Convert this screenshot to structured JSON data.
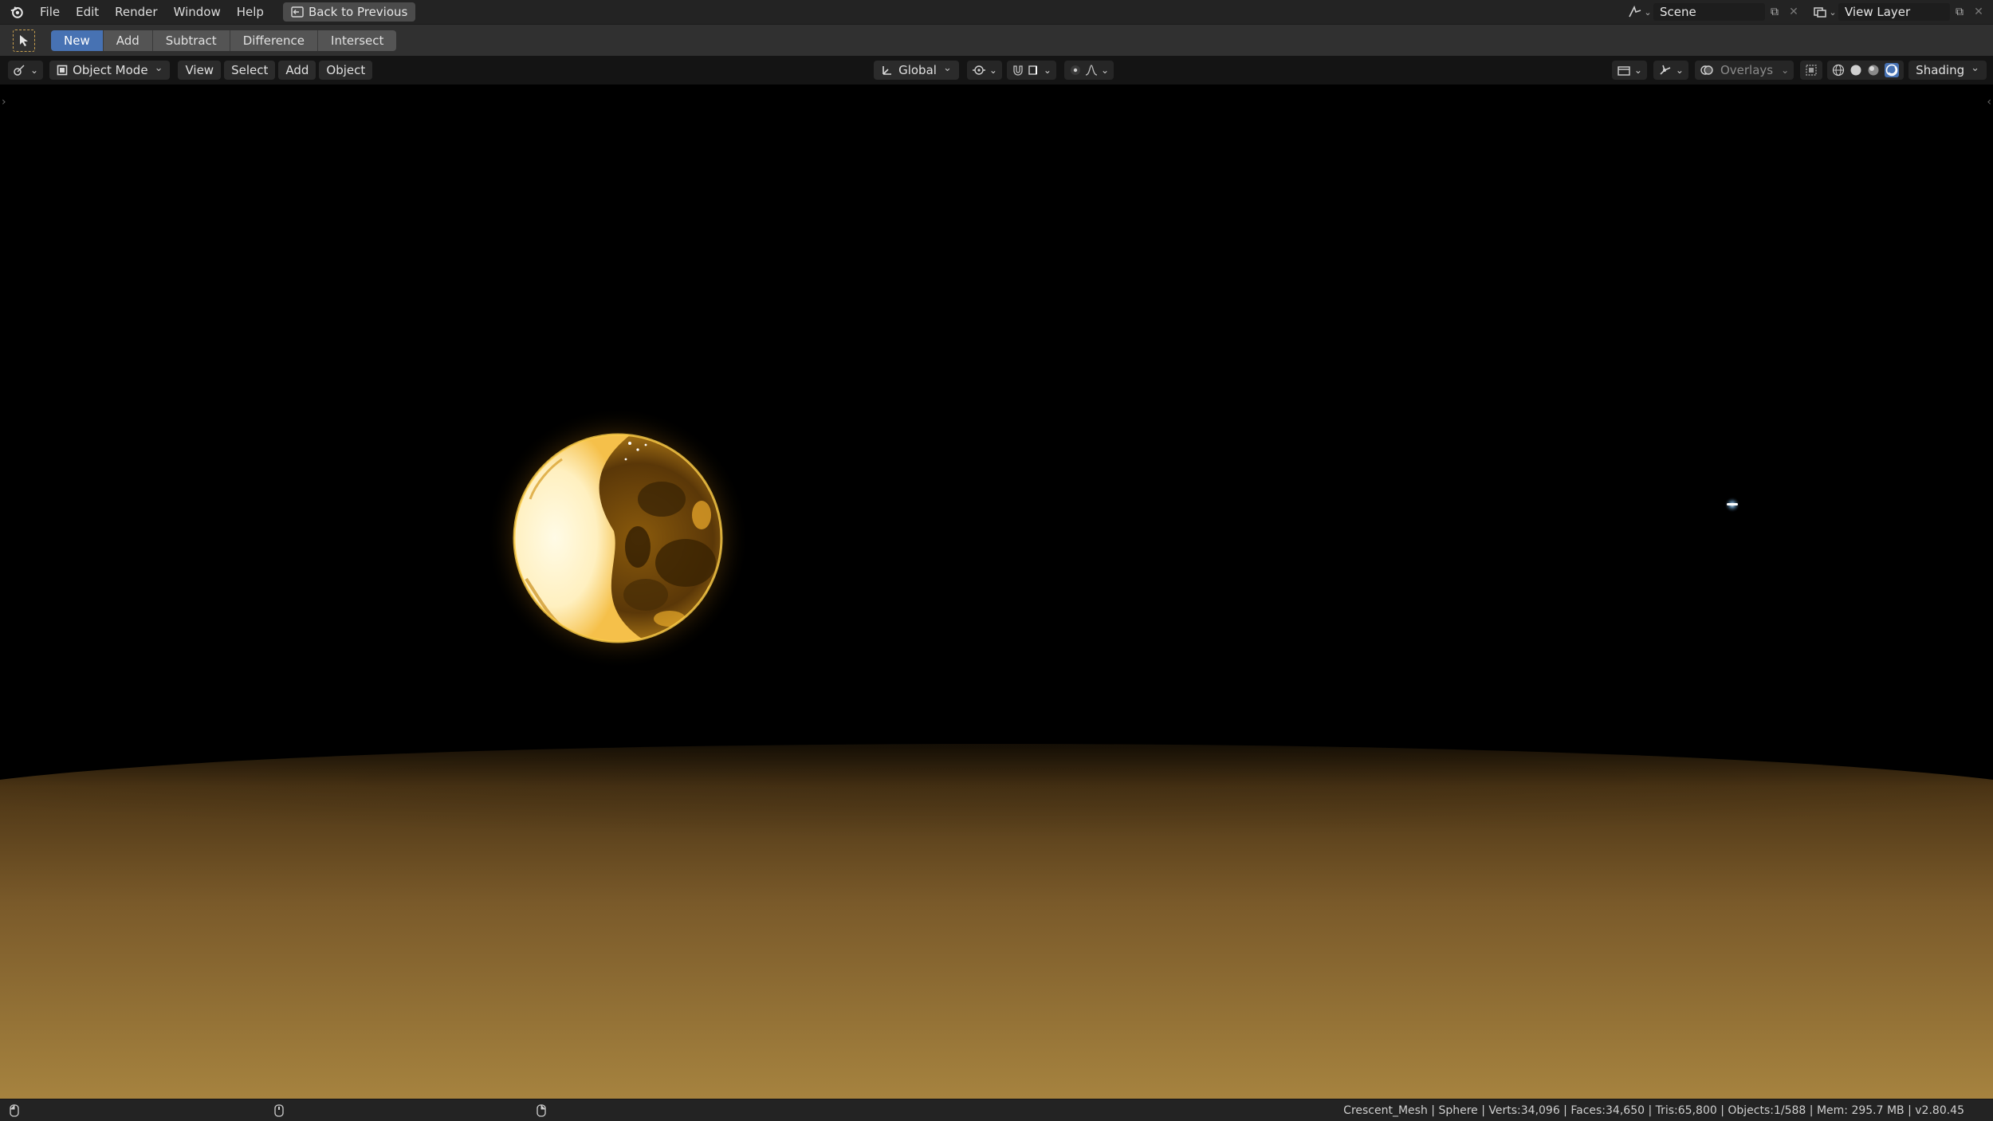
{
  "topbar": {
    "menus": [
      "File",
      "Edit",
      "Render",
      "Window",
      "Help"
    ],
    "back_button": "Back to Previous",
    "scene_name": "Scene",
    "view_layer_name": "View Layer"
  },
  "tool_header": {
    "modes": [
      {
        "label": "New",
        "active": true
      },
      {
        "label": "Add",
        "active": false
      },
      {
        "label": "Subtract",
        "active": false
      },
      {
        "label": "Difference",
        "active": false
      },
      {
        "label": "Intersect",
        "active": false
      }
    ]
  },
  "viewport_header": {
    "mode": "Object Mode",
    "menus": [
      "View",
      "Select",
      "Add",
      "Object"
    ],
    "transform_orientation": "Global",
    "overlays_label": "Overlays",
    "shading_label": "Shading"
  },
  "statusbar": {
    "info": "Crescent_Mesh | Sphere | Verts:34,096 | Faces:34,650 | Tris:65,800 | Objects:1/588 | Mem: 295.7 MB | v2.80.45"
  },
  "colors": {
    "accent": "#4772b3",
    "header_bg": "#303030",
    "topbar_bg": "#232323",
    "planet_glow": "#f7b928",
    "ground": "#9a7535"
  },
  "icons": [
    "blender-logo-icon",
    "back-to-previous-icon",
    "scene-icon",
    "view-layer-icon",
    "select-box-tool-icon",
    "editor-type-icon",
    "object-mode-icon",
    "transform-orientation-icon",
    "pivot-icon",
    "snap-icon",
    "proportional-edit-icon",
    "visibility-icon",
    "gizmo-icon",
    "overlays-icon",
    "xray-icon",
    "wireframe-shading-icon",
    "solid-shading-icon",
    "material-shading-icon",
    "rendered-shading-icon",
    "mouse-left-icon",
    "mouse-middle-icon",
    "mouse-right-icon"
  ]
}
